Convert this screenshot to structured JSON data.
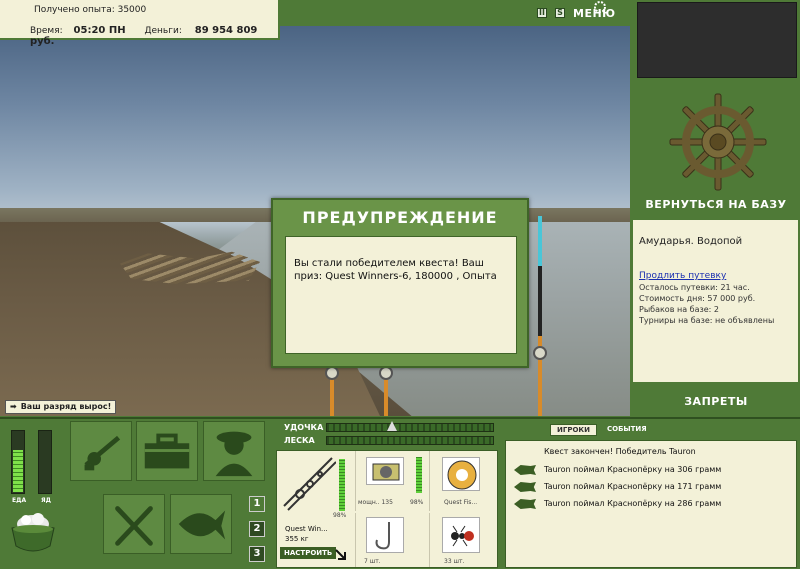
{
  "hud": {
    "exp_text": "Получено опыта: 35000",
    "time_label": "Время:",
    "time_value": "05:20 ПН",
    "money_label": "Деньги:",
    "money_value": "89 954 809 руб."
  },
  "top_icons": {
    "pause_glyph": "II",
    "sound_glyph": "S",
    "menu_label": "МЕНЮ"
  },
  "dialog": {
    "title": "ПРЕДУПРЕЖДЕНИЕ",
    "message": "Вы стали победителем квеста! Ваш приз: Quest Winners-6, 180000 , Опыта"
  },
  "toast": {
    "text": "Ваш разряд вырос!"
  },
  "right_panel": {
    "return_label": "ВЕРНУТЬСЯ НА БАЗУ",
    "location": "Амударья. Водопой",
    "extend_link": "Продлить путевку",
    "info": [
      "Осталось путевки: 21 час.",
      "Стоимость дня: 57 000 руб.",
      "Рыбаков на базе: 2",
      "Турниры на базе: не объявлены"
    ],
    "prohibitions_label": "ЗАПРЕТЫ"
  },
  "meters": {
    "food_label": "ЕДА",
    "poison_label": "ЯД",
    "food_level": 0.68,
    "poison_level": 0.0
  },
  "slots": {
    "numbers": [
      "1",
      "2",
      "3"
    ]
  },
  "rig": {
    "rod_label": "УДОЧКА",
    "line_label": "ЛЕСКА",
    "rod_name": "Quest Win...",
    "rod_weight": "355 кг",
    "rod_percent": "98%",
    "reel_caption": "мощн.. 135",
    "reel_percent": "98%",
    "line_caption": "Quest Fis...",
    "hook_caption": "7 шт.",
    "bait_caption": "33 шт.",
    "setup_label": "НАСТРОИТЬ"
  },
  "events": {
    "tab_players": "ИГРОКИ",
    "tab_events": "СОБЫТИЯ",
    "items": [
      "Квест закончен! Победитель Tauron",
      "Tauron поймал Краснопёрку на 306 грамм",
      "Tauron поймал Краснопёрку на 171 грамм",
      "Tauron поймал Краснопёрку на 286 грамм"
    ]
  },
  "colors": {
    "panel_green": "#4f7a37",
    "cream": "#f3f1d8",
    "link_blue": "#1a2fb0"
  }
}
